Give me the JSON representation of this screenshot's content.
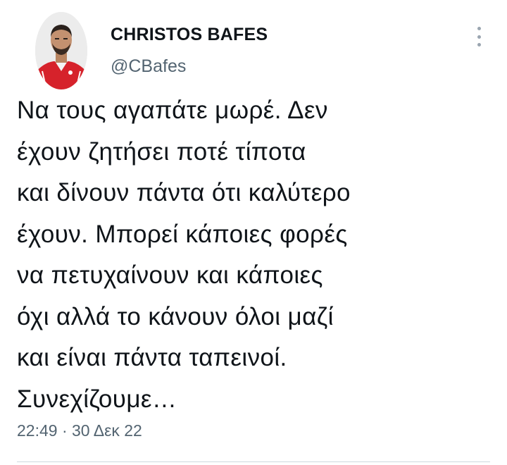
{
  "author": {
    "display_name": "CHRISTOS BAFES",
    "handle": "@CBafes"
  },
  "tweet": {
    "lines": [
      "Να τους αγαπάτε μωρέ. Δεν",
      "έχουν ζητήσει ποτέ τίποτα",
      "και δίνουν πάντα ότι καλύτερο",
      "έχουν. Μπορεί κάποιες φορές",
      "να πετυχαίνουν και κάποιες",
      "όχι αλλά το κάνουν όλοι μαζί",
      "και είναι πάντα ταπεινοί.",
      "Συνεχίζουμε…"
    ],
    "time": "22:49",
    "separator": "·",
    "date": "30 Δεκ 22"
  },
  "icons": {
    "more": "more-vertical-icon",
    "avatar": "profile-avatar"
  },
  "colors": {
    "text": "#0f1419",
    "secondary": "#536471",
    "divider": "#cfd9de",
    "jersey": "#d6222b"
  }
}
